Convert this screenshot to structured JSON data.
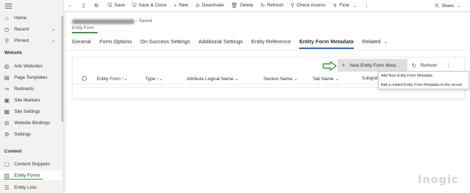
{
  "sidebar": {
    "items_top": [
      {
        "label": "Home",
        "icon": "home-icon"
      },
      {
        "label": "Recent",
        "icon": "clock-icon"
      },
      {
        "label": "Pinned",
        "icon": "pin-icon"
      }
    ],
    "section_website": "Website",
    "website_items": [
      {
        "label": "Adx Websites",
        "icon": "globe-icon"
      },
      {
        "label": "Page Templates",
        "icon": "page-icon"
      },
      {
        "label": "Redirects",
        "icon": "redirect-icon"
      },
      {
        "label": "Site Markers",
        "icon": "marker-icon"
      },
      {
        "label": "Site Settings",
        "icon": "settings-page-icon"
      },
      {
        "label": "Website Bindings",
        "icon": "link-icon"
      },
      {
        "label": "Settings",
        "icon": "gear-icon"
      }
    ],
    "section_content": "Content",
    "content_items": [
      {
        "label": "Content Snippets",
        "icon": "snippet-icon"
      },
      {
        "label": "Entity Forms",
        "icon": "form-icon"
      },
      {
        "label": "Entity Lists",
        "icon": "list-icon"
      }
    ]
  },
  "commandbar": {
    "save": "Save",
    "save_close": "Save & Close",
    "new": "New",
    "deactivate": "Deactivate",
    "delete": "Delete",
    "refresh": "Refresh",
    "check_access": "Check Access",
    "flow": "Flow",
    "share": "Share"
  },
  "form": {
    "saved_status": "- Saved",
    "entity_label": "Entity Form",
    "tabs": [
      "General",
      "Form Options",
      "On Success Settings",
      "Additional Settings",
      "Entity Reference",
      "Entity Form Metadata",
      "Related"
    ],
    "active_tab": "Entity Form Metadata"
  },
  "subgrid": {
    "new_button": "New Entity Form Meta...",
    "refresh": "Refresh",
    "columns": [
      "Entity Form",
      "Type",
      "Attribute Logical Name",
      "Section Name",
      "Tab Name",
      "Subgrid"
    ]
  },
  "tooltip": {
    "title": "Add New Entity Form Metadata",
    "description": "Add a related Entity Form Metadata to this record."
  },
  "watermark": "Inogic",
  "colors": {
    "accent_green": "#2e9e3a",
    "tab_blue": "#2266e3"
  }
}
